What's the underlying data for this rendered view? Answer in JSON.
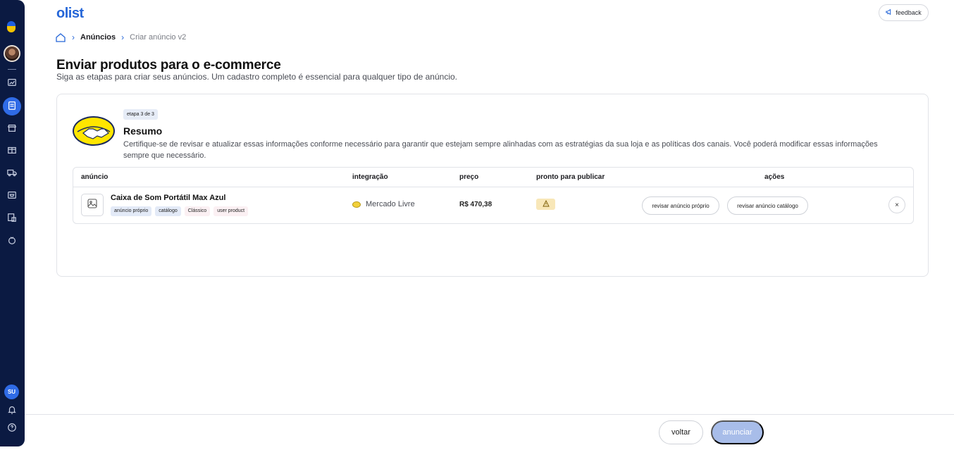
{
  "brand": {
    "name": "olist"
  },
  "header": {
    "feedback_label": "feedback",
    "feedback_icon": "megaphone-icon"
  },
  "breadcrumb": {
    "home_icon": "home-icon",
    "items": [
      "Anúncios",
      "Criar anúncio v2"
    ]
  },
  "page": {
    "title": "Enviar produtos para o e-commerce",
    "subtitle": "Siga as etapas para criar seus anúncios. Um cadastro completo é essencial para qualquer tipo de anúncio."
  },
  "sidebar": {
    "user_initials": "SU",
    "icons": [
      "logo-icon",
      "avatar",
      "chart-icon",
      "announcements-icon",
      "store-icon",
      "box-icon",
      "truck-icon",
      "cart-icon",
      "invoice-icon",
      "money-icon",
      "bell-icon",
      "help-icon"
    ],
    "active_index": 2
  },
  "card": {
    "step_label": "etapa 3 de 3",
    "title": "Resumo",
    "description": "Certifique-se de revisar e atualizar essas informações conforme necessário para garantir que estejam sempre alinhadas com as estratégias da sua loja e as políticas dos canais. Você poderá modificar essas informações sempre que necessário.",
    "logo": "mercado-livre-handshake-logo"
  },
  "table": {
    "columns": [
      "anúncio",
      "integração",
      "preço",
      "pronto para publicar",
      "ações"
    ],
    "rows": [
      {
        "product_name": "Caixa de Som Portátil Max Azul",
        "tags": [
          "anúncio próprio",
          "catálogo",
          "Clássico",
          "user product"
        ],
        "integration": "Mercado Livre",
        "price": "R$ 470,38",
        "ready_status": "warning",
        "actions": [
          "revisar anúncio próprio",
          "revisar anúncio catálogo"
        ],
        "remove_symbol": "×"
      }
    ]
  },
  "footer": {
    "back_label": "voltar",
    "submit_label": "anunciar"
  },
  "colors": {
    "accent": "#2566d8",
    "sidebar_bg": "#0b1a42",
    "disabled_button": "#a8bde9",
    "warning_bg": "#f8e7b8"
  }
}
